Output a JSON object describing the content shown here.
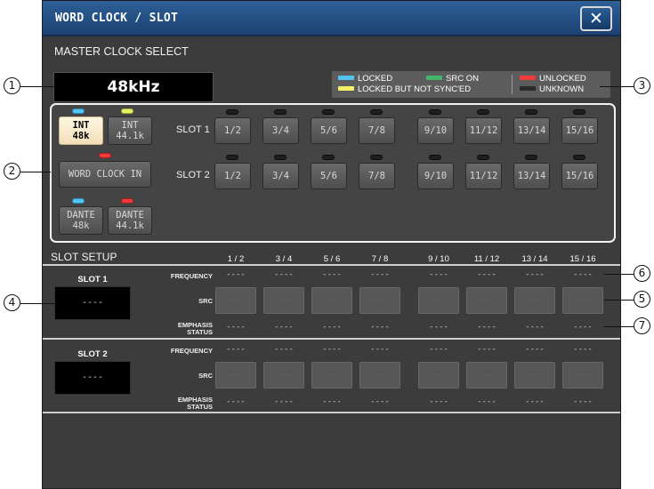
{
  "window": {
    "title": "WORD CLOCK / SLOT",
    "close_symbol": "✕"
  },
  "master_clock": {
    "heading": "MASTER CLOCK SELECT",
    "frequency": "48kHz"
  },
  "legend": {
    "locked": "LOCKED",
    "src_on": "SRC ON",
    "unlocked": "UNLOCKED",
    "locked_not_synced": "LOCKED BUT NOT SYNC'ED",
    "unknown": "UNKNOWN",
    "colors": {
      "locked": "#54c4f4",
      "src_on": "#43b66b",
      "unlocked": "#f23c3c",
      "locked_not_synced": "#f4f06a",
      "unknown": "#2a2a2a"
    }
  },
  "clock_sources": {
    "int_48k": {
      "line1": "INT",
      "line2": "48k",
      "selected": true,
      "led": "blue"
    },
    "int_44k": {
      "line1": "INT",
      "line2": "44.1k",
      "led": "yellow"
    },
    "word_clock_in": {
      "label": "WORD CLOCK IN",
      "led": "red"
    },
    "dante_48k": {
      "line1": "DANTE",
      "line2": "48k",
      "led": "blue"
    },
    "dante_44k": {
      "line1": "DANTE",
      "line2": "44.1k",
      "led": "red"
    }
  },
  "slot_buttons": {
    "slot1_label": "SLOT 1",
    "slot2_label": "SLOT 2",
    "channels": [
      "1/2",
      "3/4",
      "5/6",
      "7/8",
      "9/10",
      "11/12",
      "13/14",
      "15/16"
    ]
  },
  "slot_setup": {
    "heading": "SLOT SETUP",
    "columns": [
      "1 / 2",
      "3 / 4",
      "5 / 6",
      "7 / 8",
      "9 / 10",
      "11 / 12",
      "13 / 14",
      "15 / 16"
    ],
    "row_frequency": "FREQUENCY",
    "row_src": "SRC",
    "row_emphasis_1": "EMPHASIS",
    "row_emphasis_2": "STATUS",
    "empty_value": "----",
    "slots": [
      {
        "name": "SLOT 1",
        "status": "----"
      },
      {
        "name": "SLOT 2",
        "status": "----"
      }
    ]
  },
  "callouts": [
    "1",
    "2",
    "3",
    "4",
    "5",
    "6",
    "7"
  ]
}
